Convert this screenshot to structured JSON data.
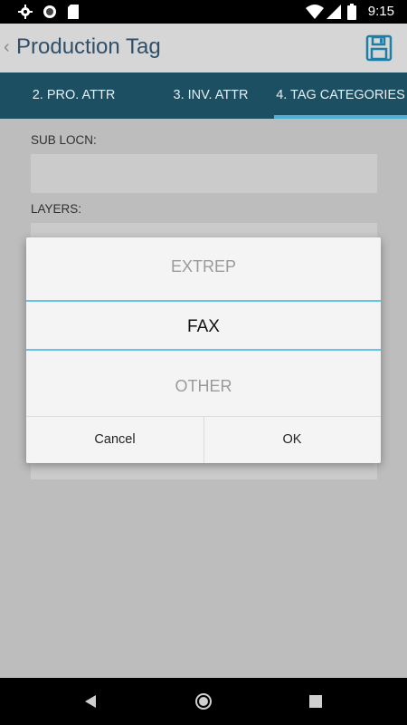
{
  "status_bar": {
    "icons": [
      "settings-icon",
      "sync-icon",
      "sd-card-icon",
      "wifi-icon",
      "signal-icon",
      "battery-icon"
    ],
    "time": "9:15"
  },
  "app_bar": {
    "back_icon": "chevron-left",
    "back_glyph": "‹",
    "title": "Production Tag",
    "save_icon": "save-icon"
  },
  "tabs": {
    "items": [
      {
        "label": "2. PRO. ATTR"
      },
      {
        "label": "3. INV. ATTR"
      },
      {
        "label": "4. TAG CATEGORIES"
      }
    ],
    "selected_index": 2
  },
  "form": {
    "sub_locn_label": "SUB LOCN:",
    "layers_label": "LAYERS:"
  },
  "picker_dialog": {
    "options": [
      "EXTREP",
      "FAX",
      "OTHER"
    ],
    "selected": "FAX",
    "cancel_label": "Cancel",
    "ok_label": "OK"
  },
  "nav_bar": {
    "icons": [
      "back-triangle-icon",
      "home-circle-icon",
      "recents-square-icon"
    ]
  },
  "colors": {
    "tab_bar": "#1d4f63",
    "tab_indicator": "#4fb0d4",
    "title": "#2f4f6a",
    "picker_divider": "#64c3e6",
    "save_icon": "#1d7fa8"
  }
}
